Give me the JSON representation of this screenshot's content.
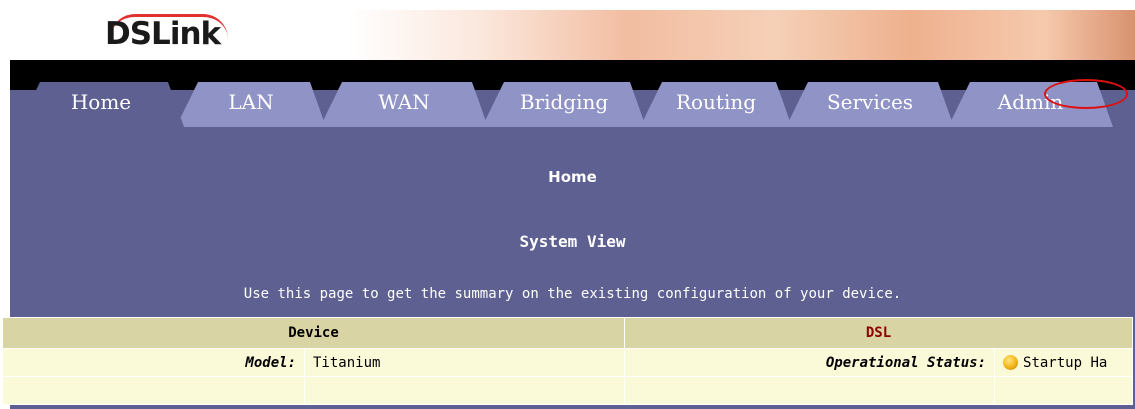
{
  "header": {
    "logo_text": "DSLink"
  },
  "tabs": [
    {
      "label": "Home",
      "active": true
    },
    {
      "label": "LAN"
    },
    {
      "label": "WAN"
    },
    {
      "label": "Bridging"
    },
    {
      "label": "Routing"
    },
    {
      "label": "Services"
    },
    {
      "label": "Admin",
      "highlighted": true
    }
  ],
  "page": {
    "title": "Home",
    "section": "System View",
    "description": "Use this page to get the summary on the existing configuration of your device."
  },
  "summary_table": {
    "device_header": "Device",
    "dsl_header": "DSL",
    "rows": [
      {
        "label": "Model:",
        "value": "Titanium",
        "dsl_label": "Operational Status:",
        "dsl_value": "Startup Ha"
      }
    ]
  },
  "colors": {
    "panel_bg": "#5d6090",
    "tab_bg": "#8f93c5",
    "table_header_bg": "#d9d4a4",
    "table_row_bg": "#fbfad8",
    "highlight_ring": "#e01010",
    "dsl_header_color": "#8b0000"
  }
}
